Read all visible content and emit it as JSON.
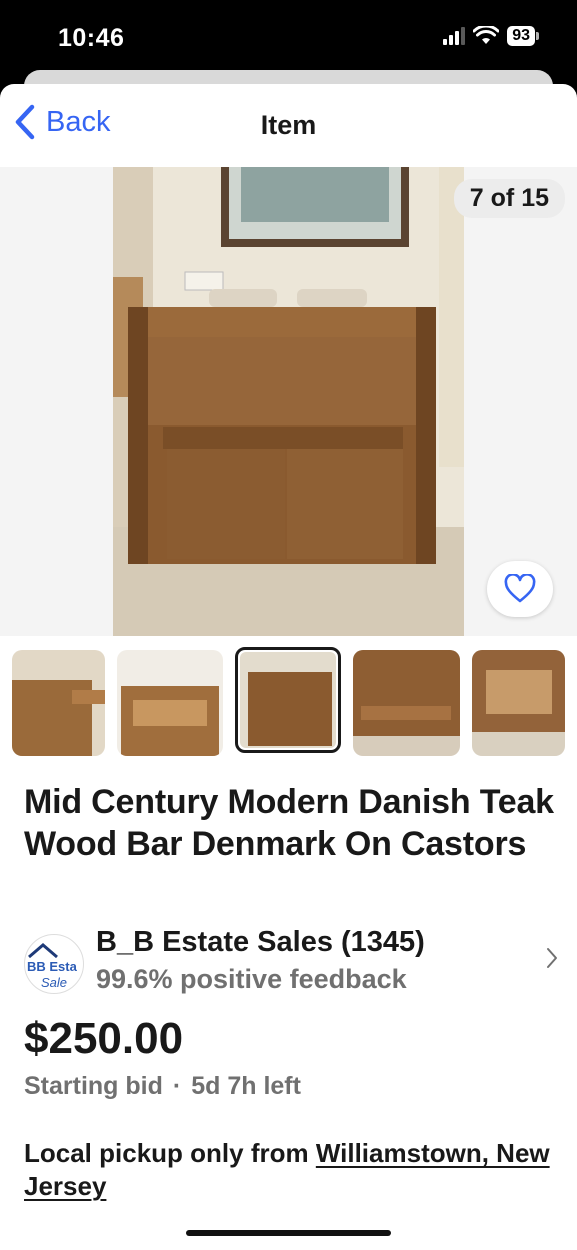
{
  "status_bar": {
    "time": "10:46",
    "battery": "93"
  },
  "nav": {
    "back_label": "Back",
    "title": "Item"
  },
  "gallery": {
    "counter": "7 of 15",
    "thumbnail_count": 5,
    "selected_index": 2
  },
  "listing": {
    "title": "Mid Century Modern Danish Teak Wood Bar Denmark On Castors",
    "seller": {
      "name": "B_B Estate Sales (1345)",
      "feedback": "99.6% positive feedback",
      "avatar_text_top": "BB Esta",
      "avatar_text_bottom": "Sale"
    },
    "price": "$250.00",
    "bid_type": "Starting bid",
    "separator": "·",
    "time_left": "5d 7h left",
    "pickup_prefix": "Local pickup only from ",
    "pickup_location": "Williamstown, New Jersey"
  },
  "colors": {
    "accent": "#3665f3",
    "text": "#191919",
    "muted": "#707070"
  }
}
